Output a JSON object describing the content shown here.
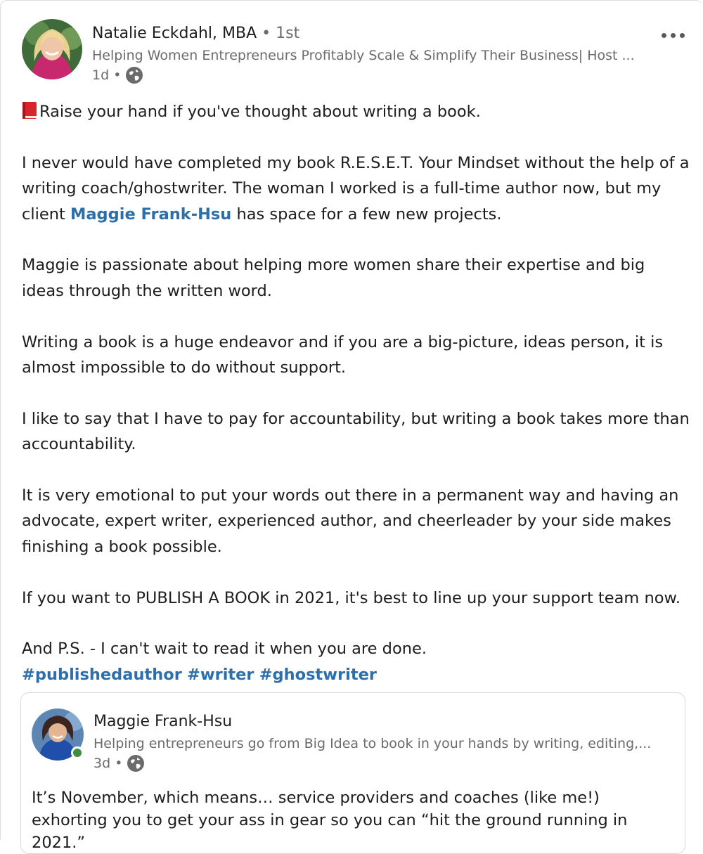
{
  "post": {
    "author": {
      "name": "Natalie Eckdahl, MBA",
      "degree": "• 1st",
      "headline": "Helping Women Entrepreneurs Profitably Scale & Simplify Their Business| Host ...",
      "time": "1d •"
    },
    "more_icon": "more-horizontal-icon",
    "body": {
      "p1": "Raise your hand if you've thought about writing a book.",
      "p2_before": "I never would have completed my book R.E.S.E.T. Your Mindset without the help of a writing coach/ghostwriter. The woman I worked is a full-time author now, but my client ",
      "p2_mention": "Maggie Frank-Hsu",
      "p2_after": " has space for a few new projects.",
      "p3": "Maggie is passionate about helping more women share their expertise and big ideas through the written word.",
      "p4": "Writing a book is a huge endeavor and if you are a big-picture, ideas person, it is almost impossible to do without support.",
      "p5": "I like to say that I have to pay for accountability, but writing a book takes more than accountability.",
      "p6": "It is very emotional to put your words out there in a permanent way and having an advocate, expert writer, experienced author, and cheerleader by your side makes finishing a book possible.",
      "p7": "If you want to PUBLISH A BOOK in 2021, it's best to line up your support team now.",
      "p8": "And P.S. - I can't wait to read it when you are done.",
      "hashtags": [
        "#publishedauthor",
        "#writer",
        "#ghostwriter"
      ]
    },
    "shared": {
      "author": {
        "name": "Maggie Frank-Hsu",
        "headline": "Helping entrepreneurs go from Big Idea to book in your hands by writing, editing,...",
        "time": "3d •"
      },
      "body": "It’s November, which means… service providers and coaches (like me!) exhorting you to get your ass in gear so you can “hit the ground running in 2021.”"
    },
    "colors": {
      "link": "#2f6fa9",
      "muted": "#6b6b6b",
      "online": "#3f8e3f"
    }
  }
}
